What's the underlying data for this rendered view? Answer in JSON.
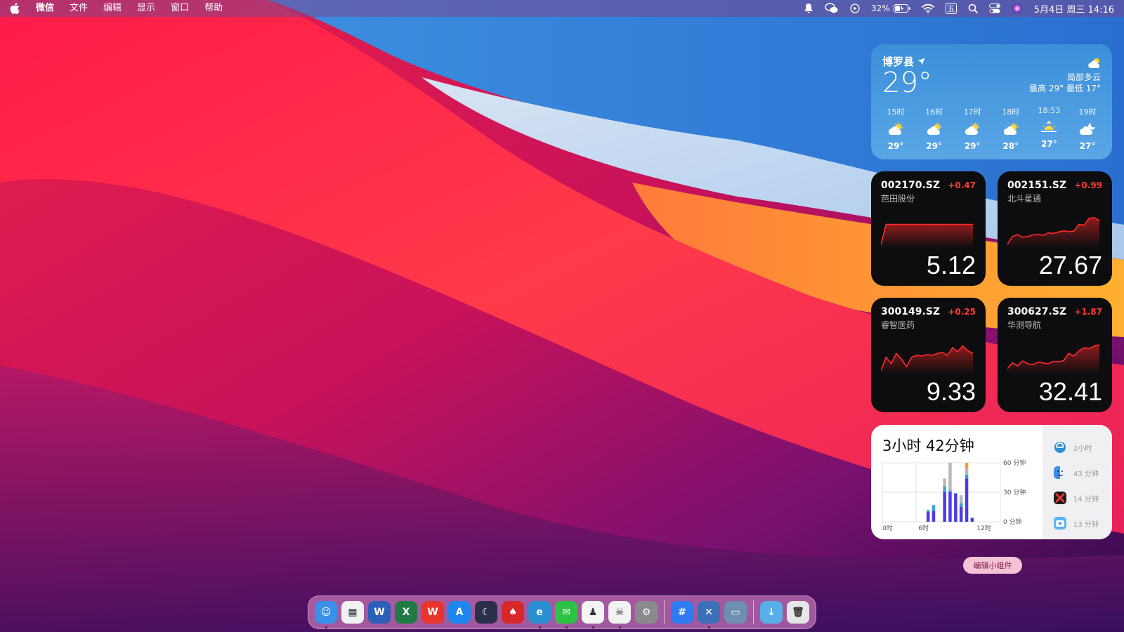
{
  "menubar": {
    "app_name": "微信",
    "menus": [
      "文件",
      "编辑",
      "显示",
      "窗口",
      "帮助"
    ],
    "battery_percent": "32%",
    "input_method": "五",
    "datetime": "5月4日 周三  14:16"
  },
  "weather": {
    "location": "博罗县",
    "temperature": "29°",
    "condition": "局部多云",
    "high_low": "最高 29° 最低 17°",
    "hourly": [
      {
        "time": "15时",
        "icon": "partly-cloudy-sun-icon",
        "temp": "29°"
      },
      {
        "time": "16时",
        "icon": "partly-cloudy-sun-icon",
        "temp": "29°"
      },
      {
        "time": "17时",
        "icon": "partly-cloudy-sun-icon",
        "temp": "29°"
      },
      {
        "time": "18时",
        "icon": "partly-cloudy-sun-icon",
        "temp": "28°"
      },
      {
        "time": "18:53",
        "icon": "sunset-icon",
        "temp": "27°"
      },
      {
        "time": "19时",
        "icon": "cloudy-night-icon",
        "temp": "27°"
      }
    ]
  },
  "stocks": [
    {
      "code": "002170.SZ",
      "name": "芭田股份",
      "change": "+0.47",
      "price": "5.12",
      "trend": [
        0.08,
        0.62,
        0.62,
        0.62,
        0.62,
        0.62,
        0.62,
        0.62,
        0.62,
        0.62,
        0.62,
        0.62,
        0.62,
        0.62,
        0.62,
        0.62,
        0.62,
        0.62,
        0.62
      ]
    },
    {
      "code": "002151.SZ",
      "name": "北斗星通",
      "change": "+0.99",
      "price": "27.67",
      "trend": [
        0.1,
        0.3,
        0.35,
        0.28,
        0.3,
        0.34,
        0.36,
        0.33,
        0.4,
        0.38,
        0.42,
        0.45,
        0.43,
        0.44,
        0.62,
        0.6,
        0.78,
        0.8,
        0.72
      ]
    },
    {
      "code": "300149.SZ",
      "name": "睿智医药",
      "change": "+0.25",
      "price": "9.33",
      "trend": [
        0.1,
        0.45,
        0.28,
        0.55,
        0.4,
        0.2,
        0.45,
        0.5,
        0.48,
        0.52,
        0.5,
        0.55,
        0.58,
        0.5,
        0.7,
        0.6,
        0.75,
        0.62,
        0.55
      ]
    },
    {
      "code": "300627.SZ",
      "name": "华测导航",
      "change": "+1.87",
      "price": "32.41",
      "trend": [
        0.15,
        0.3,
        0.22,
        0.35,
        0.28,
        0.25,
        0.32,
        0.3,
        0.28,
        0.34,
        0.33,
        0.36,
        0.55,
        0.48,
        0.62,
        0.7,
        0.68,
        0.75,
        0.78
      ]
    }
  ],
  "screen_time": {
    "total": "3小时 42分钟",
    "y_labels": [
      "60 分钟",
      "30 分钟",
      "0 分钟"
    ],
    "x_labels": [
      "0时",
      "6时",
      "12时"
    ],
    "apps": [
      {
        "icon": "edge-icon",
        "duration": "2小时"
      },
      {
        "icon": "finder-icon",
        "duration": "43 分钟"
      },
      {
        "icon": "xmind-icon",
        "duration": "14 分钟"
      },
      {
        "icon": "screenshot-icon",
        "duration": "13 分钟"
      }
    ],
    "chart_data": {
      "type": "bar",
      "x_label_values": [
        "0时",
        "6时",
        "12时"
      ],
      "hours": [
        7,
        8,
        10,
        11,
        12,
        13,
        14,
        15
      ],
      "series": [
        {
          "color": "#4b3de0",
          "values": [
            10,
            11,
            30,
            30,
            29,
            15,
            44,
            4
          ]
        },
        {
          "color": "#3aa0d8",
          "values": [
            2,
            6,
            6,
            2,
            0,
            4,
            4,
            0
          ]
        },
        {
          "color": "#b8b8b8",
          "values": [
            0,
            0,
            8,
            28,
            0,
            8,
            6,
            0
          ]
        },
        {
          "color": "#f0a030",
          "values": [
            0,
            0,
            0,
            0,
            0,
            0,
            6,
            0
          ]
        }
      ],
      "ylim": [
        0,
        60
      ]
    }
  },
  "edit_widgets_label": "编辑小组件",
  "dock": {
    "apps": [
      {
        "icon": "finder-icon",
        "color": "#3a8fe8",
        "glyph": "☺",
        "running": true
      },
      {
        "icon": "launchpad-icon",
        "color": "#f1f1f1",
        "glyph": "▦",
        "running": false
      },
      {
        "icon": "word-icon",
        "color": "#2b5fb8",
        "glyph": "W",
        "running": false
      },
      {
        "icon": "excel-icon",
        "color": "#1f7a45",
        "glyph": "X",
        "running": false
      },
      {
        "icon": "wps-icon",
        "color": "#e8362d",
        "glyph": "W",
        "running": false
      },
      {
        "icon": "app-store-icon",
        "color": "#1f86f0",
        "glyph": "A",
        "running": false
      },
      {
        "icon": "cat-app-icon",
        "color": "#2c2f4a",
        "glyph": "☾",
        "running": false
      },
      {
        "icon": "red-app-icon",
        "color": "#d8282a",
        "glyph": "♠",
        "running": false
      },
      {
        "icon": "edge-icon",
        "color": "#2a8fd0",
        "glyph": "e",
        "running": true
      },
      {
        "icon": "wechat-icon",
        "color": "#2dc146",
        "glyph": "✉",
        "running": true
      },
      {
        "icon": "qq-icon",
        "color": "#f4f4f4",
        "glyph": "♟",
        "running": true
      },
      {
        "icon": "alien-app-icon",
        "color": "#f2f2f2",
        "glyph": "☠",
        "running": true
      },
      {
        "icon": "system-preferences-icon",
        "color": "#8a8a8e",
        "glyph": "⚙",
        "running": false
      }
    ],
    "apps2": [
      {
        "icon": "hashtag-app-icon",
        "color": "#2f7bf0",
        "glyph": "#",
        "running": false
      },
      {
        "icon": "xcode-icon",
        "color": "#3d6fb8",
        "glyph": "✕",
        "running": true
      },
      {
        "icon": "preview-icon",
        "color": "#6e8fb0",
        "glyph": "▭",
        "running": false
      }
    ],
    "apps3": [
      {
        "icon": "downloads-folder-icon",
        "color": "#5aaee8",
        "glyph": "↓",
        "running": false
      },
      {
        "icon": "trash-icon",
        "color": "#e6e6e6",
        "glyph": "🗑",
        "running": false
      }
    ]
  }
}
